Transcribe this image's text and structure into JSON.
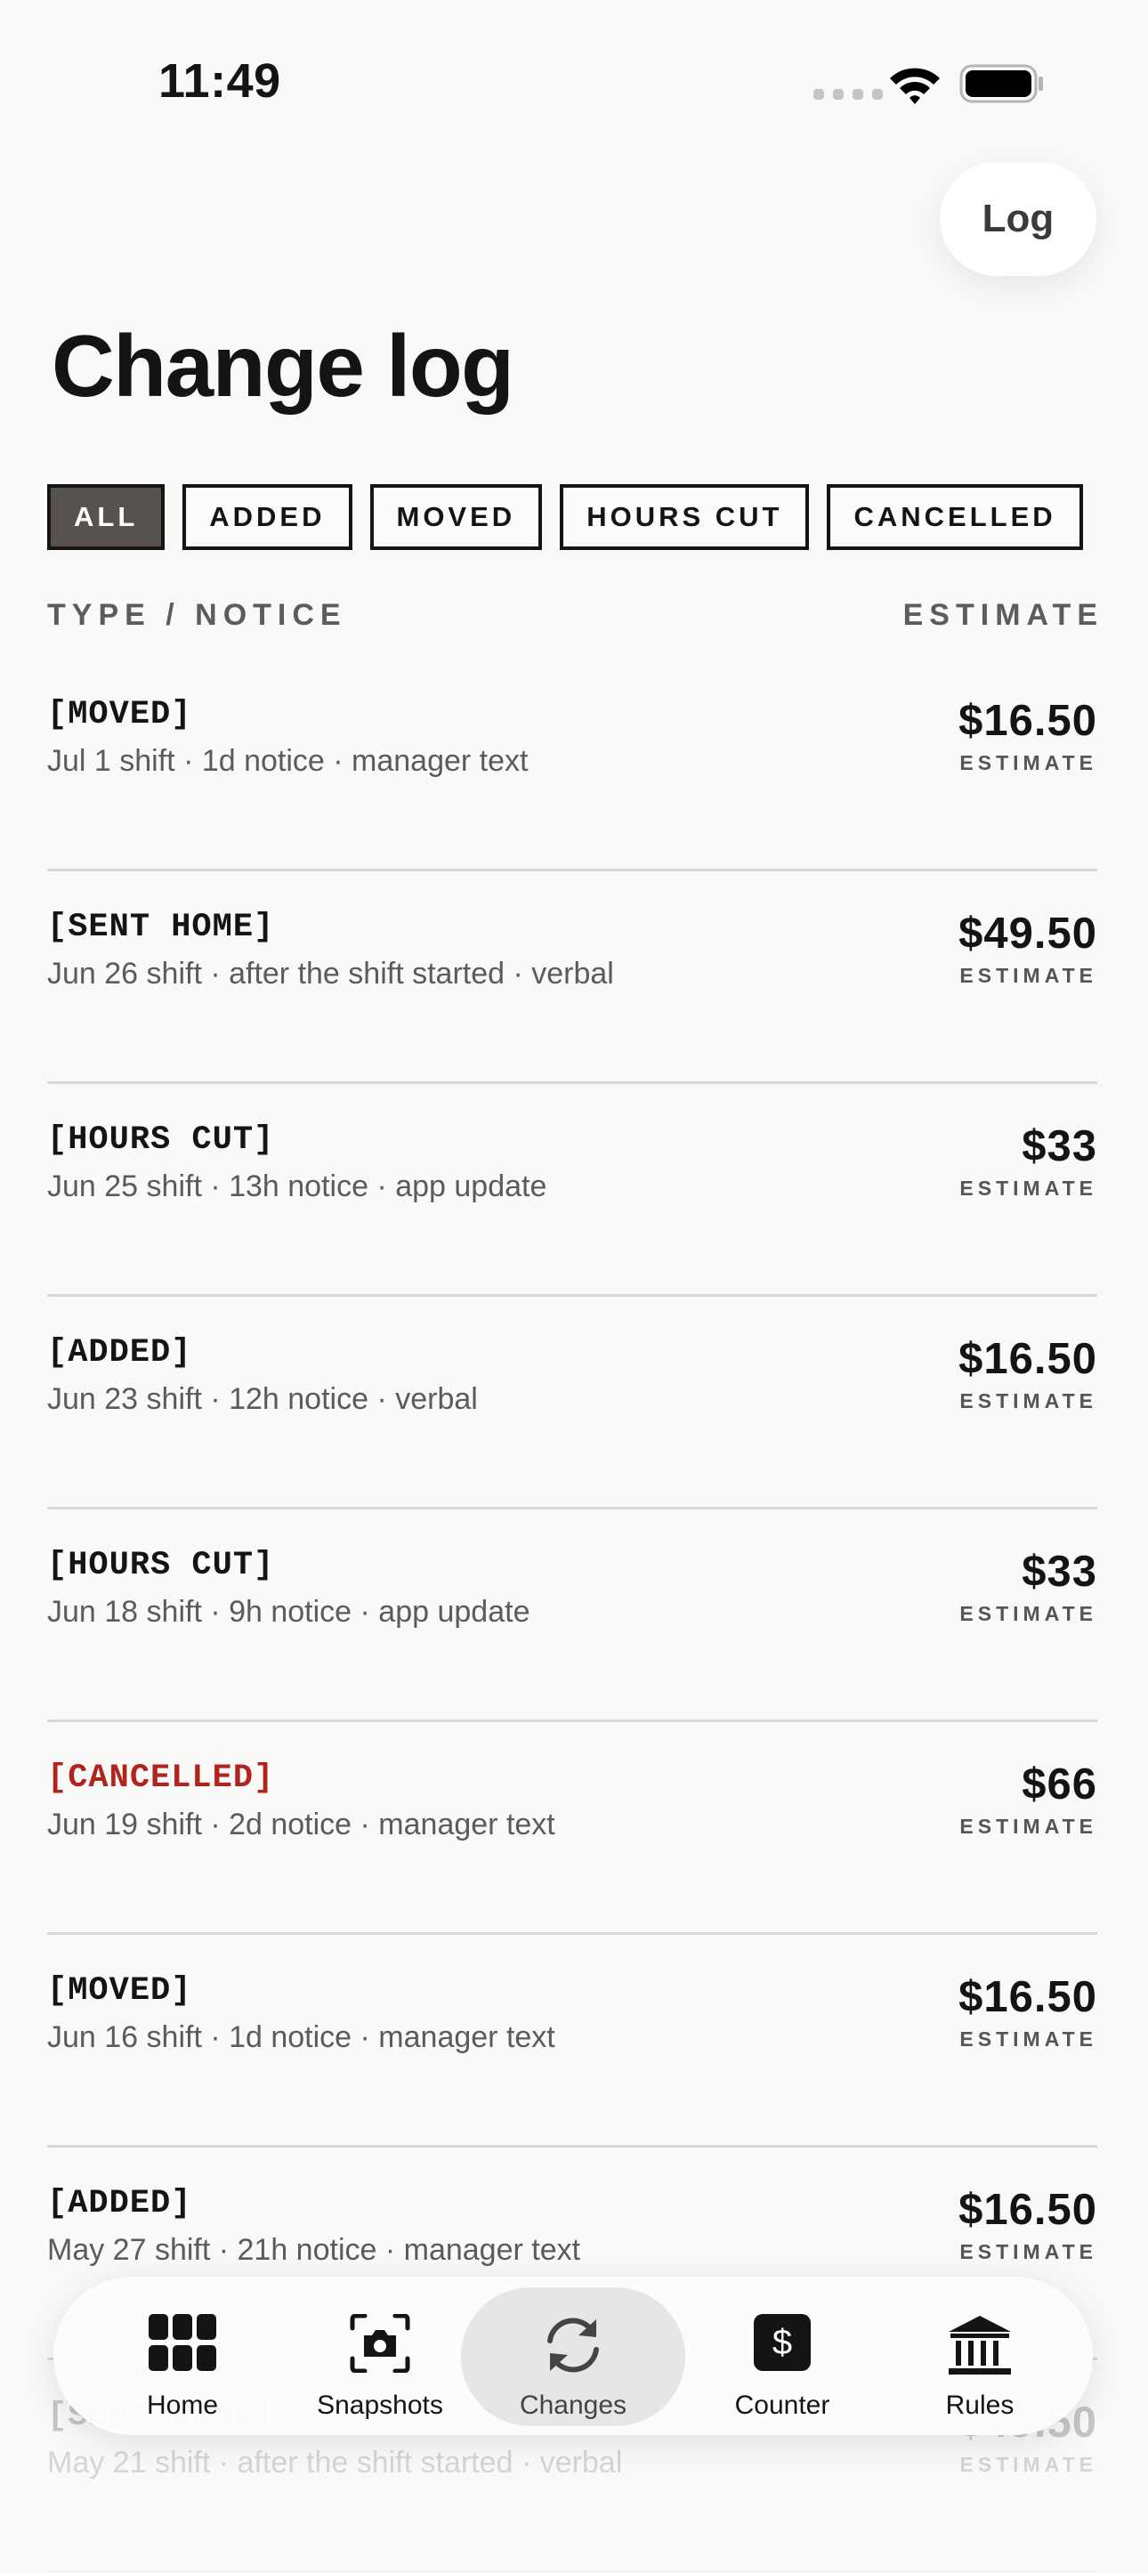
{
  "status": {
    "time": "11:49"
  },
  "header": {
    "log_button": "Log",
    "title": "Change log"
  },
  "filters": [
    "ALL",
    "ADDED",
    "MOVED",
    "HOURS CUT",
    "CANCELLED"
  ],
  "active_filter": "ALL",
  "columns": {
    "left": "TYPE / NOTICE",
    "right": "ESTIMATE"
  },
  "changes": [
    {
      "type": "[MOVED]",
      "meta": "Jul 1 shift · 1d notice · manager text",
      "amount": "$16.50",
      "amount_label": "ESTIMATE"
    },
    {
      "type": "[SENT HOME]",
      "meta": "Jun 26 shift · after the shift started · verbal",
      "amount": "$49.50",
      "amount_label": "ESTIMATE"
    },
    {
      "type": "[HOURS CUT]",
      "meta": "Jun 25 shift · 13h notice · app update",
      "amount": "$33",
      "amount_label": "ESTIMATE"
    },
    {
      "type": "[ADDED]",
      "meta": "Jun 23 shift · 12h notice · verbal",
      "amount": "$16.50",
      "amount_label": "ESTIMATE"
    },
    {
      "type": "[HOURS CUT]",
      "meta": "Jun 18 shift · 9h notice · app update",
      "amount": "$33",
      "amount_label": "ESTIMATE"
    },
    {
      "type": "[CANCELLED]",
      "meta": "Jun 19 shift · 2d notice · manager text",
      "amount": "$66",
      "amount_label": "ESTIMATE",
      "color": "#b3231e"
    },
    {
      "type": "[MOVED]",
      "meta": "Jun 16 shift · 1d notice · manager text",
      "amount": "$16.50",
      "amount_label": "ESTIMATE"
    },
    {
      "type": "[ADDED]",
      "meta": "May 27 shift · 21h notice · manager text",
      "amount": "$16.50",
      "amount_label": "ESTIMATE"
    },
    {
      "type": "[SENT HOME]",
      "meta": "May 21 shift · after the shift started · verbal",
      "amount": "$49.50",
      "amount_label": "ESTIMATE"
    }
  ],
  "tab_bar": {
    "items": [
      {
        "label": "Home",
        "icon": "grid-icon"
      },
      {
        "label": "Snapshots",
        "icon": "camera-icon"
      },
      {
        "label": "Changes",
        "icon": "sync-arrows-icon"
      },
      {
        "label": "Counter",
        "icon": "dollar-icon"
      },
      {
        "label": "Rules",
        "icon": "bank-icon"
      }
    ],
    "active": "Changes"
  },
  "colors": {
    "background": "#f9f9f8",
    "text": "#141414",
    "accent_red": "#b3231e",
    "chip_active": "#57524d"
  }
}
